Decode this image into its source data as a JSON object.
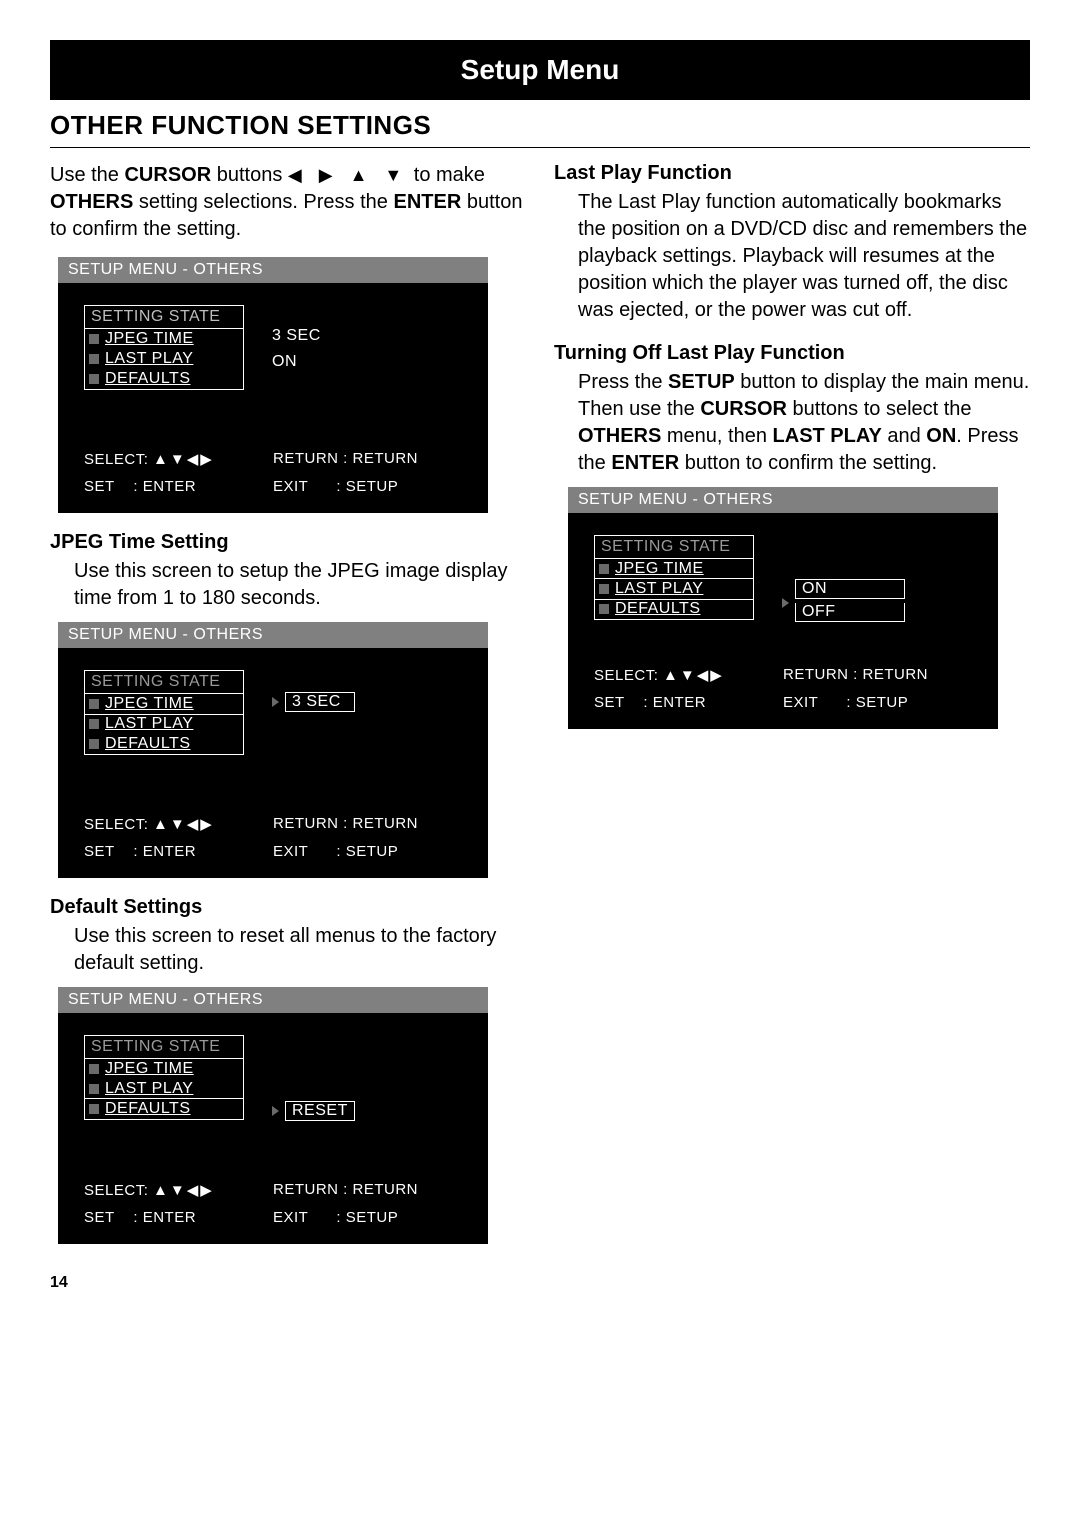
{
  "banner": "Setup Menu",
  "section_title": "OTHER FUNCTION SETTINGS",
  "intro": {
    "pre": "Use the ",
    "cursor": "CURSOR",
    "mid1": " buttons ",
    "arrows": "◀ ▶ ▲ ▼",
    "mid2": " to make ",
    "others": "OTHERS",
    "mid3": " setting selections. Press the ",
    "enter": "ENTER",
    "post": " button to confirm the setting."
  },
  "osd_title": "SETUP MENU - OTHERS",
  "menu": {
    "header": "SETTING STATE",
    "items": [
      "JPEG TIME",
      "LAST PLAY",
      "DEFAULTS"
    ]
  },
  "legend": {
    "select": "SELECT:",
    "select_sym": "▲▼◀▶",
    "return": "RETURN : RETURN",
    "set": "SET",
    "set_val": ": ENTER",
    "exit": "EXIT",
    "exit_val": ": SETUP"
  },
  "left": {
    "jpeg": {
      "heading": "JPEG Time Setting",
      "text": "Use this screen to setup the JPEG image display time from 1 to 180 seconds.",
      "value": "3  SEC"
    },
    "default": {
      "heading": "Default Settings",
      "text": "Use this screen to reset all menus to the factory default setting.",
      "value": "RESET"
    }
  },
  "right": {
    "lastplay": {
      "heading": "Last Play Function",
      "text": "The Last Play function automatically bookmarks the position on a DVD/CD disc and remembers the playback settings. Playback will resumes at the position which the player was turned off, the disc was ejected, or the power was cut off."
    },
    "turnoff": {
      "heading": "Turning Off Last Play Function",
      "pre": "Press the ",
      "setup": "SETUP",
      "mid1": " button to display the main menu. Then use the ",
      "cursor": "CURSOR",
      "mid2": " buttons to select the ",
      "others": "OTHERS",
      "mid3": " menu, then ",
      "lastplay": "LAST PLAY",
      "mid4": " and ",
      "on": "ON",
      "mid5": ". Press the ",
      "enter": "ENTER",
      "post": " button to confirm the setting."
    },
    "osd_values": {
      "on": "ON",
      "off": "OFF"
    }
  },
  "first_osd_values": {
    "v1": "3 SEC",
    "v2": "ON"
  },
  "page_number": "14"
}
